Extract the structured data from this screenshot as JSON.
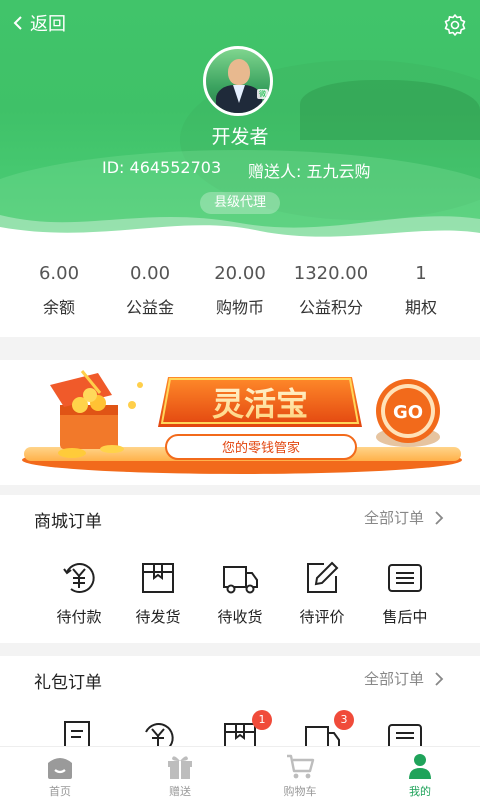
{
  "header": {
    "back_label": "返回",
    "user_name": "开发者",
    "user_id": "ID: 464552703",
    "referrer": "赠送人: 五九云购",
    "level": "县级代理",
    "avatar_tag": "微"
  },
  "stats": [
    {
      "value": "6.00",
      "label": "余额"
    },
    {
      "value": "0.00",
      "label": "公益金"
    },
    {
      "value": "20.00",
      "label": "购物币"
    },
    {
      "value": "1320.00",
      "label": "公益积分"
    },
    {
      "value": "1",
      "label": "期权"
    }
  ],
  "banner": {
    "title": "灵活宝",
    "subtitle": "您的零钱管家",
    "go_label": "GO"
  },
  "mall_orders": {
    "title": "商城订单",
    "more_label": "全部订单",
    "items": [
      {
        "label": "待付款",
        "icon": "yen-circle-icon"
      },
      {
        "label": "待发货",
        "icon": "box-icon"
      },
      {
        "label": "待收货",
        "icon": "truck-icon"
      },
      {
        "label": "待评价",
        "icon": "edit-icon"
      },
      {
        "label": "售后中",
        "icon": "list-icon"
      }
    ]
  },
  "gift_orders": {
    "title": "礼包订单",
    "more_label": "全部订单",
    "badges": {
      "box": "1",
      "truck": "3"
    }
  },
  "tabbar": [
    {
      "label": "首页",
      "icon": "home-icon"
    },
    {
      "label": "赠送",
      "icon": "gift-icon"
    },
    {
      "label": "购物车",
      "icon": "cart-icon"
    },
    {
      "label": "我的",
      "icon": "user-icon",
      "active": true
    }
  ],
  "colors": {
    "brand_green": "#3fc168",
    "active_tab": "#1fa35a",
    "badge_red": "#f04b3a",
    "banner_orange": "#f26a1b"
  }
}
